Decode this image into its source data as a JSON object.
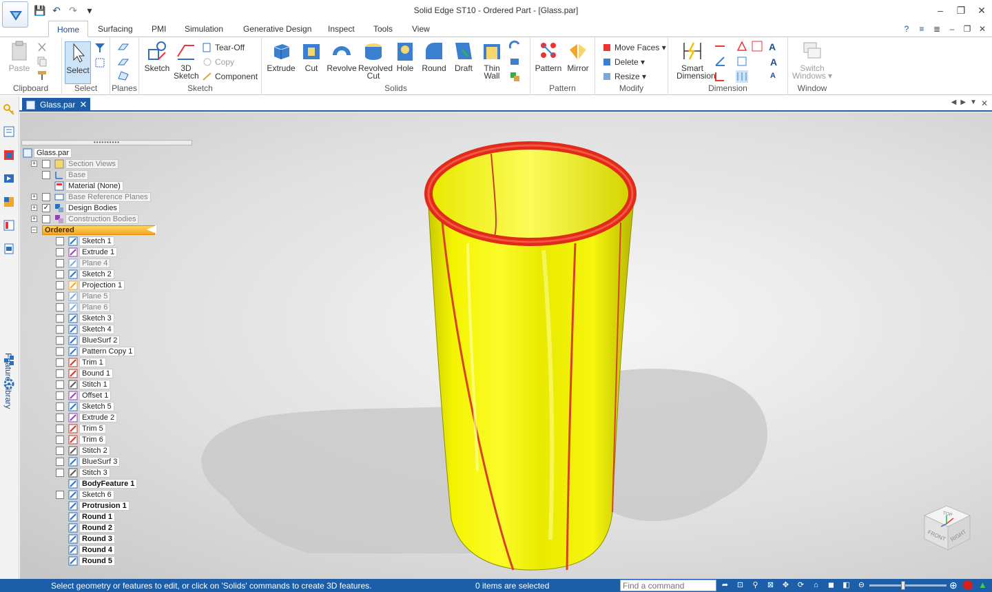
{
  "window": {
    "title": "Solid Edge ST10 - Ordered Part - [Glass.par]",
    "minimize": "–",
    "restore": "❐",
    "close": "✕"
  },
  "quick_access": {
    "save": "💾",
    "undo": "↶",
    "redo": "↷",
    "customize": "▾"
  },
  "tabs": [
    "Home",
    "Surfacing",
    "PMI",
    "Simulation",
    "Generative Design",
    "Inspect",
    "Tools",
    "View"
  ],
  "ribbon": {
    "clipboard": {
      "label": "Clipboard",
      "paste": "Paste"
    },
    "select": {
      "label": "Select",
      "select": "Select"
    },
    "planes": {
      "label": "Planes"
    },
    "sketch": {
      "label": "Sketch",
      "sketch": "Sketch",
      "sketch3d_1": "3D",
      "sketch3d_2": "Sketch",
      "tearoff": "Tear-Off",
      "copy": "Copy",
      "component": "Component"
    },
    "solids": {
      "label": "Solids",
      "extrude": "Extrude",
      "cut": "Cut",
      "revolve": "Revolve",
      "revolved_cut_1": "Revolved",
      "revolved_cut_2": "Cut",
      "hole": "Hole",
      "round": "Round",
      "draft": "Draft",
      "thinwall_1": "Thin",
      "thinwall_2": "Wall"
    },
    "pattern": {
      "label": "Pattern",
      "pattern": "Pattern",
      "mirror": "Mirror"
    },
    "modify": {
      "label": "Modify",
      "move_faces": "Move Faces",
      "delete": "Delete",
      "resize": "Resize"
    },
    "dimension": {
      "label": "Dimension",
      "smart_1": "Smart",
      "smart_2": "Dimension"
    },
    "window": {
      "label": "Window",
      "switch_1": "Switch",
      "switch_2": "Windows"
    }
  },
  "left_strip": {
    "feature_library": "Feature Library"
  },
  "document_tab": {
    "name": "Glass.par",
    "close": "✕"
  },
  "tree": {
    "root": "Glass.par",
    "items": [
      {
        "label": "Section Views"
      },
      {
        "label": "Base"
      },
      {
        "label": "Material (None)"
      },
      {
        "label": "Base Reference Planes"
      },
      {
        "label": "Design Bodies"
      },
      {
        "label": "Construction Bodies"
      },
      {
        "label": "Ordered"
      },
      {
        "label": "Sketch 1"
      },
      {
        "label": "Extrude 1"
      },
      {
        "label": "Plane 4"
      },
      {
        "label": "Sketch 2"
      },
      {
        "label": "Projection 1"
      },
      {
        "label": "Plane 5"
      },
      {
        "label": "Plane 6"
      },
      {
        "label": "Sketch 3"
      },
      {
        "label": "Sketch 4"
      },
      {
        "label": "BlueSurf 2"
      },
      {
        "label": "Pattern Copy 1"
      },
      {
        "label": "Trim 1"
      },
      {
        "label": "Bound 1"
      },
      {
        "label": "Stitch 1"
      },
      {
        "label": "Offset 1"
      },
      {
        "label": "Sketch 5"
      },
      {
        "label": "Extrude 2"
      },
      {
        "label": "Trim 5"
      },
      {
        "label": "Trim 6"
      },
      {
        "label": "Stitch 2"
      },
      {
        "label": "BlueSurf 3"
      },
      {
        "label": "Stitch 3"
      },
      {
        "label": "BodyFeature 1"
      },
      {
        "label": "Sketch 6"
      },
      {
        "label": "Protrusion 1"
      },
      {
        "label": "Round 1"
      },
      {
        "label": "Round 2"
      },
      {
        "label": "Round 3"
      },
      {
        "label": "Round 4"
      },
      {
        "label": "Round 5"
      }
    ]
  },
  "view_cube": {
    "top": "TOP",
    "front": "FRONT",
    "right": "RIGHT"
  },
  "status": {
    "prompt": "Select geometry or features to edit, or click on 'Solids' commands to create 3D features.",
    "selection": "0 items are selected",
    "find_placeholder": "Find a command"
  },
  "colors": {
    "accent": "#1c5fa8",
    "glass_yellow": "#f2f20a",
    "rim_red": "#e02a1a",
    "ordered_highlight": "#f5a623"
  }
}
